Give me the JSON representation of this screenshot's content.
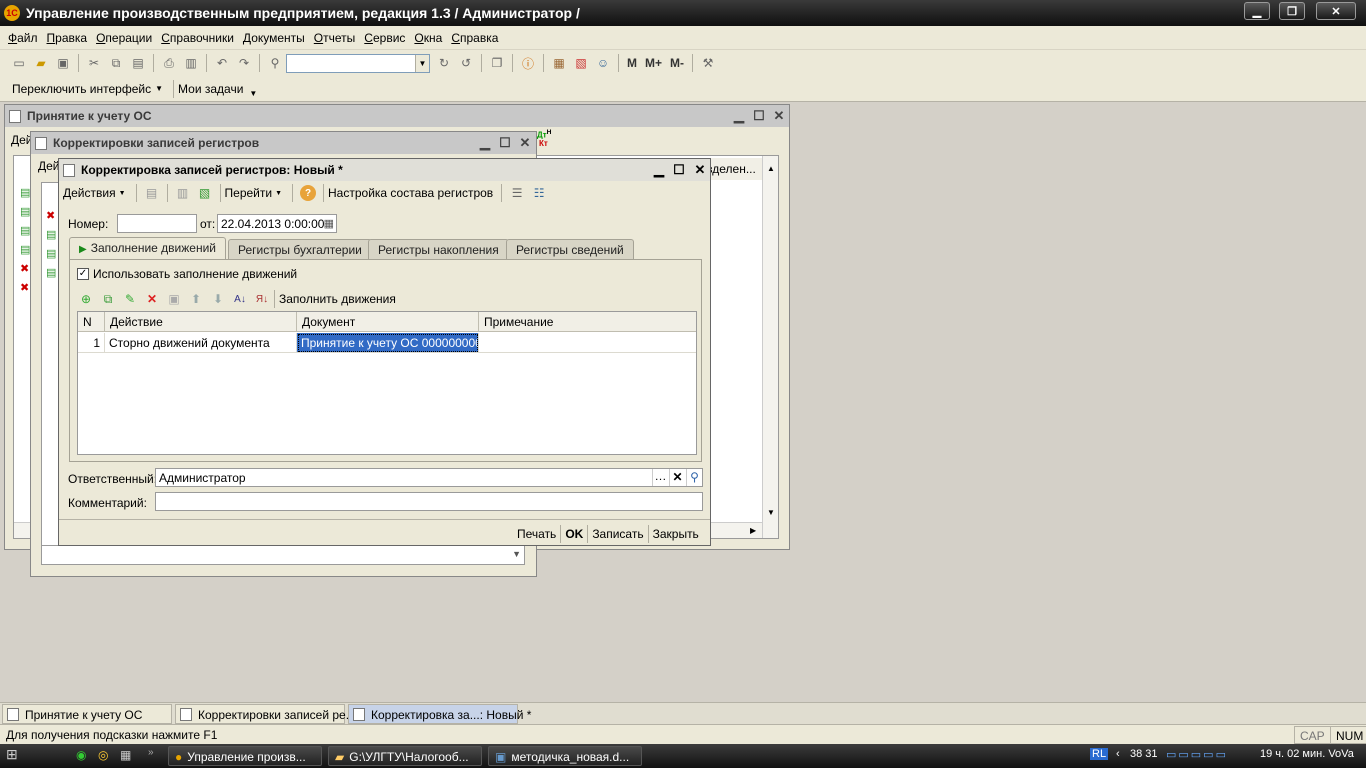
{
  "app": {
    "title": "Управление производственным предприятием, редакция 1.3 / Администратор /"
  },
  "menu": [
    "Файл",
    "Правка",
    "Операции",
    "Справочники",
    "Документы",
    "Отчеты",
    "Сервис",
    "Окна",
    "Справка"
  ],
  "toolbar2": {
    "switch_interface": "Переключить интерфейс",
    "my_tasks": "Мои задачи"
  },
  "toolbar_labels": {
    "m": "M",
    "mplus": "M+",
    "mminus": "M-"
  },
  "win1": {
    "title": "Принятие к учету ОС",
    "partial": "Дей",
    "col": "зделен...",
    "dt": "Дт",
    "kt": "Кт",
    "h": "Н"
  },
  "win2": {
    "title": "Корректировки записей регистров",
    "partial": "Дей"
  },
  "win3": {
    "title": "Корректировка записей регистров: Новый *",
    "toolbar": {
      "actions": "Действия",
      "goto": "Перейти",
      "reg_setup": "Настройка состава регистров"
    },
    "number_label": "Номер:",
    "number_value": "",
    "date_label": "от:",
    "date_value": "22.04.2013  0:00:00",
    "tabs": [
      "Заполнение движений",
      "Регистры бухгалтерии",
      "Регистры накопления",
      "Регистры сведений"
    ],
    "checkbox_label": "Использовать заполнение движений",
    "fill_label": "Заполнить движения",
    "table": {
      "headers": [
        "N",
        "Действие",
        "Документ",
        "Примечание"
      ],
      "rows": [
        [
          "1",
          "Сторно движений документа",
          "Принятие к учету ОС 000000000...",
          ""
        ]
      ]
    },
    "responsible_label": "Ответственный:",
    "responsible_value": "Администратор",
    "comment_label": "Комментарий:",
    "comment_value": "",
    "buttons": {
      "print": "Печать",
      "ok": "OK",
      "save": "Записать",
      "close": "Закрыть"
    }
  },
  "window_tabs": [
    "Принятие к учету ОС",
    "Корректировки записей ре...",
    "Корректировка за...: Новый *"
  ],
  "status": {
    "hint": "Для получения подсказки нажмите F1",
    "cap": "CAP",
    "num": "NUM"
  },
  "taskbar": {
    "items": [
      "Управление произв...",
      "G:\\УЛГТУ\\Налогооб...",
      "методичка_новая.d..."
    ],
    "lang": "RL",
    "tray_nums": "38  31",
    "clock": "19 ч. 02 мин. VoVa"
  },
  "colors": {
    "accent_selection": "#316ac5",
    "title_bg": "#1a1a1a"
  }
}
